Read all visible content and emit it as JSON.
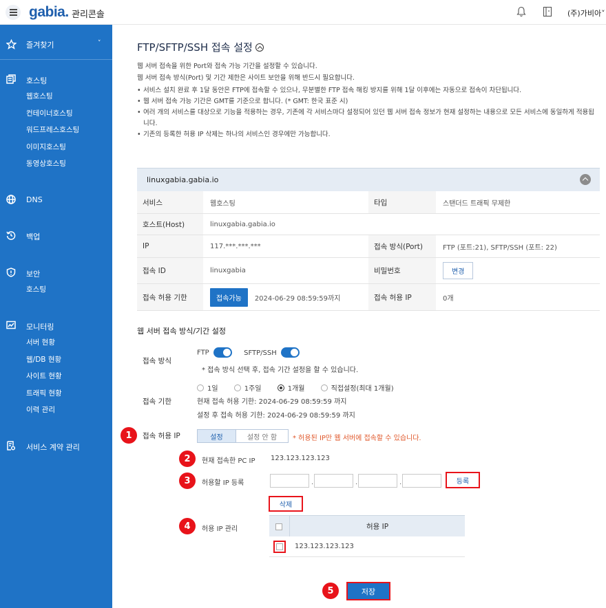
{
  "topbar": {
    "logo": "gabia.",
    "app_title": "관리콘솔",
    "company": "(주)가비아"
  },
  "sidebar": {
    "favorites": "즐겨찾기",
    "groups": [
      {
        "label": "호스팅",
        "items": [
          "웹호스팅",
          "컨테이너호스팅",
          "워드프레스호스팅",
          "이미지호스팅",
          "동영상호스팅"
        ]
      },
      {
        "label": "DNS",
        "items": []
      },
      {
        "label": "백업",
        "items": []
      },
      {
        "label": "보안",
        "items": [
          "호스팅"
        ]
      },
      {
        "label": "모니터링",
        "items": [
          "서버 현황",
          "웹/DB 현황",
          "사이트 현황",
          "트래픽 현황",
          "이력 관리"
        ]
      },
      {
        "label": "서비스 계약 관리",
        "items": []
      }
    ]
  },
  "page": {
    "title": "FTP/SFTP/SSH 접속 설정",
    "desc1": "웹 서버 접속을 위한 Port와 접속 가능 기간을 설정할 수 있습니다.",
    "desc2": "웹 서버 접속 방식(Port) 및 기간 제한은 사이트 보안을 위해 반드시 필요합니다.",
    "bullets": [
      "서비스 설치 완료 후 1달 동안은 FTP에 접속할 수 있으나, 무분별한 FTP 접속 해킹 방지를 위해 1달 이후에는 자동으로 접속이 차단됩니다.",
      "웹 서버 접속 가능 기간은 GMT를 기준으로 합니다. (* GMT: 한국 표준 시)",
      "여러 개의 서비스를 대상으로 기능을 적용하는 경우, 기존에 각 서비스마다 설정되어 있던 웹 서버 접속 정보가 현재 설정하는 내용으로 모든 서비스에 동일하게 적용됩니다.",
      "기존의 등록한 허용 IP 삭제는 하나의 서비스인 경우에만 가능합니다."
    ]
  },
  "info": {
    "host": "linuxgabia.gabia.io",
    "service_label": "서비스",
    "service": "웹호스팅",
    "type_label": "타입",
    "type": "스탠더드 트래픽 무제한",
    "host_label": "호스트(Host)",
    "host_value": "linuxgabia.gabia.io",
    "ip_label": "IP",
    "ip": "117.***.***.***",
    "port_label": "접속 방식(Port)",
    "port": "FTP (포트:21), SFTP/SSH (포트: 22)",
    "id_label": "접속 ID",
    "id": "linuxgabia",
    "pw_label": "비밀번호",
    "pw_button": "변경",
    "period_label": "접속 허용 기한",
    "period_button": "접속가능",
    "period": "2024-06-29 08:59:59까지",
    "allow_ip_label": "접속 허용 IP",
    "allow_ip": "0개"
  },
  "settings": {
    "section_title": "웹 서버 접속 방식/기간 설정",
    "method_label": "접속 방식",
    "ftp": "FTP",
    "sftp": "SFTP/SSH",
    "method_note": "* 접속 방식 선택 후, 접속 기간 설정을 할 수 있습니다.",
    "period_label": "접속 기한",
    "options": [
      "1일",
      "1주일",
      "1개월",
      "직접설정(최대 1개월)"
    ],
    "selected_option": "1개월",
    "current_period": "현재 접속 허용 기한: 2024-06-29 08:59:59 까지",
    "after_period": "설정 후 접속 허용 기한: 2024-06-29 08:59:59 까지",
    "allow_ip_label": "접속 허용 IP",
    "seg_on": "설정",
    "seg_off": "설정 안 함",
    "warning": "* 허용된 IP만 웹 서버에 접속할 수 있습니다.",
    "current_pc_label": "현재 접속한 PC IP",
    "current_pc_ip": "123.123.123.123",
    "register_label": "허용할 IP 등록",
    "register_button": "등록",
    "delete_button": "삭제",
    "manage_label": "허용 IP 관리",
    "table_header": "허용 IP",
    "table_rows": [
      "123.123.123.123"
    ],
    "save_button": "저장"
  },
  "steps": [
    "1",
    "2",
    "3",
    "4",
    "5"
  ],
  "colors": {
    "brand": "#1f73c6",
    "highlight": "#e8131a",
    "warning": "#e0582b"
  }
}
